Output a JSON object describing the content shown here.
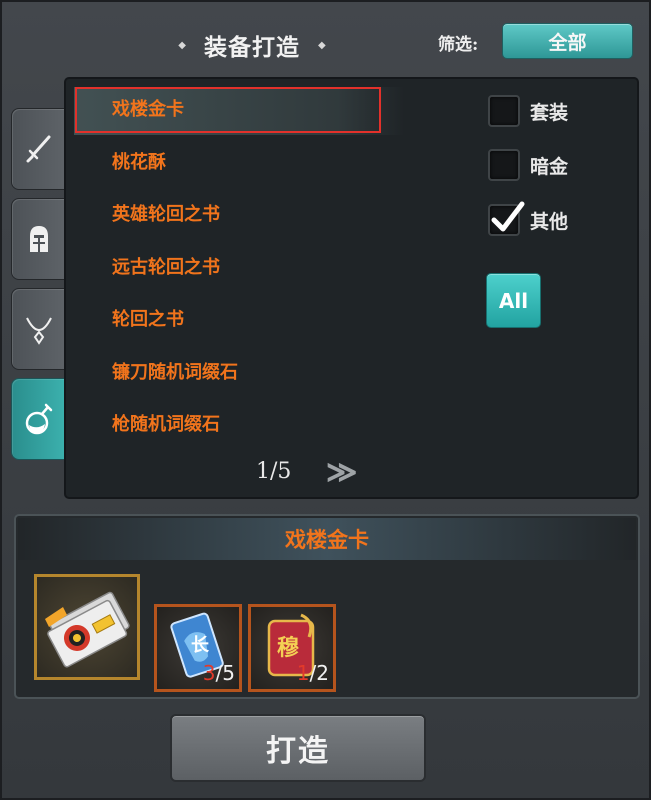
{
  "header": {
    "title": "装备打造",
    "filter_label": "筛选:",
    "filter_value": "全部"
  },
  "tabs": [
    {
      "name": "weapon",
      "icon": "sword-icon"
    },
    {
      "name": "armor",
      "icon": "helmet-icon"
    },
    {
      "name": "accessory",
      "icon": "necklace-icon"
    },
    {
      "name": "consumable",
      "icon": "potion-icon",
      "active": true
    }
  ],
  "list": {
    "items": [
      {
        "label": "戏楼金卡",
        "selected": true
      },
      {
        "label": "桃花酥"
      },
      {
        "label": "英雄轮回之书"
      },
      {
        "label": "远古轮回之书"
      },
      {
        "label": "轮回之书"
      },
      {
        "label": "镰刀随机词缀石"
      },
      {
        "label": "枪随机词缀石"
      }
    ],
    "page": "1/5",
    "next_symbol": "≫"
  },
  "filters": {
    "checkboxes": [
      {
        "label": "套装",
        "checked": false
      },
      {
        "label": "暗金",
        "checked": false
      },
      {
        "label": "其他",
        "checked": true
      }
    ],
    "all_button": "All"
  },
  "detail": {
    "title": "戏楼金卡",
    "product_icon": "golden-card-icon",
    "materials": [
      {
        "icon": "chang-card-icon",
        "have": "3",
        "need": "/5"
      },
      {
        "icon": "mu-card-icon",
        "have": "1",
        "need": "/2"
      }
    ]
  },
  "forge_button": "打造",
  "colors": {
    "accent_teal": "#3cb1ae",
    "item_orange": "#f1741c",
    "selection_red": "#e2312b",
    "gold_border": "#b5862d"
  }
}
